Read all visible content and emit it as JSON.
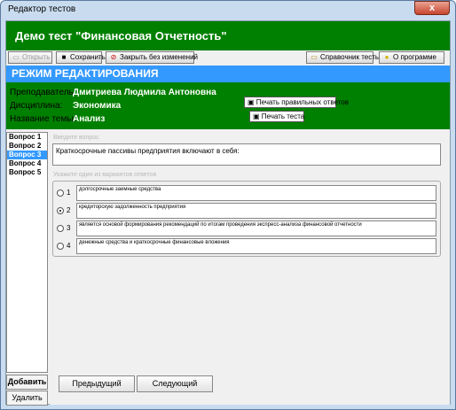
{
  "window": {
    "title": "Редактор тестов",
    "close_glyph": "x"
  },
  "app_title": "Демо тест \"Финансовая Отчетность\"",
  "toolbar": {
    "open_label": "Открыть",
    "save_label": "Сохранить",
    "close_nosave_label": "Закрыть без изменений",
    "reference_label": "Справочник тесты",
    "about_label": "О программе"
  },
  "mode_label": "РЕЖИМ РЕДАКТИРОВАНИЯ",
  "info": {
    "teacher_label": "Преподаватель:",
    "teacher_value": "Дмитриева Людмила Антоновна",
    "discipline_label": "Дисциплина:",
    "discipline_value": "Экономика",
    "topic_label": "Название темы:",
    "topic_value": "Анализ",
    "print_answers_label": "Печать правильных ответов",
    "print_test_label": "Печать теста"
  },
  "questions": [
    "Вопрос 1",
    "Вопрос 2",
    "Вопрос 3",
    "Вопрос 4",
    "Вопрос 5"
  ],
  "selected_question": 3,
  "editor": {
    "question_hint": "Введите вопрос",
    "question_text": "Краткосрочные пассивы предприятия включают в себя:",
    "answers_hint": "Укажите один из вариантов ответов",
    "answers": [
      {
        "num": "1",
        "text": "долгосрочные заемные средства",
        "selected": false
      },
      {
        "num": "2",
        "text": "кредиторскую задолженность предприятия",
        "selected": true
      },
      {
        "num": "3",
        "text": "является основой формирования рекомендаций по итогам проведения экспресс-анализа финансовой отчетности",
        "selected": false
      },
      {
        "num": "4",
        "text": "денежные средства и краткосрочные финансовые вложения",
        "selected": false
      }
    ]
  },
  "side_buttons": {
    "add_label": "Добавить",
    "delete_label": "Удалить"
  },
  "nav": {
    "prev_label": "Предыдущий",
    "next_label": "Следующий"
  },
  "colors": {
    "banner": "#008000",
    "mode_bar": "#3399ff",
    "selected": "#3399ff"
  },
  "icons": {
    "open": "folder-icon",
    "save": "floppy-icon",
    "close_nosave": "stop-icon",
    "reference": "folder-icon",
    "about": "bulb-icon",
    "print": "printer-icon"
  }
}
